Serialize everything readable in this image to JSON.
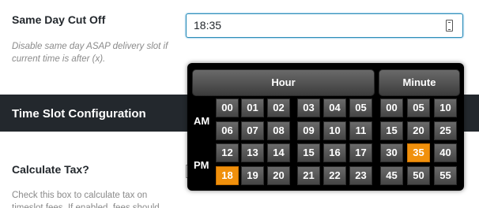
{
  "same_day": {
    "label": "Same Day Cut Off",
    "help_line1": "Disable same day ASAP delivery slot if",
    "help_line2": "current time is after (x).",
    "value": "18:35"
  },
  "section": {
    "title": "Time Slot Configuration"
  },
  "tax": {
    "label": "Calculate Tax?",
    "help_line1": "Check this box to calculate tax on",
    "help_line2": "timeslot fees. If enabled, fees should"
  },
  "picker": {
    "hour_header": "Hour",
    "minute_header": "Minute",
    "am_label": "AM",
    "pm_label": "PM",
    "am_hours": [
      "00",
      "01",
      "02",
      "03",
      "04",
      "05",
      "06",
      "07",
      "08",
      "09",
      "10",
      "11"
    ],
    "pm_hours": [
      "12",
      "13",
      "14",
      "15",
      "16",
      "17",
      "18",
      "19",
      "20",
      "21",
      "22",
      "23"
    ],
    "minutes": [
      "00",
      "05",
      "10",
      "15",
      "20",
      "25",
      "30",
      "35",
      "40",
      "45",
      "50",
      "55"
    ],
    "selected_hour": "18",
    "selected_minute": "35",
    "accent_color": "#f0900c"
  }
}
